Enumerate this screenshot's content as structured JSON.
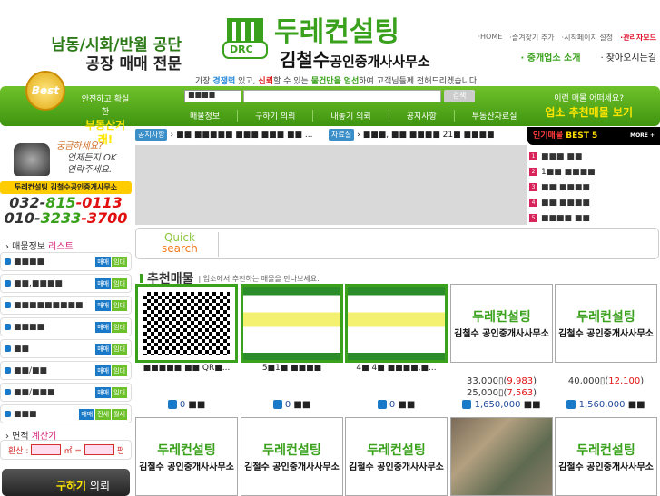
{
  "header": {
    "tagline_line1": "남동/시화/반월 공단",
    "tagline_line2": "공장 매매 전문",
    "logo_main": "두레컨설팅",
    "logo_sub": "김철수",
    "logo_sub2": "공인중개사사무소",
    "logo_mark": "DRC",
    "slogan": [
      "가장 ",
      "경쟁력",
      " 있고, ",
      "신뢰",
      "할 수 있는 ",
      "물건만을",
      " ",
      "엄선",
      "하여 고객님들께 전해드리겠습니다."
    ],
    "top_links": [
      "·HOME",
      "·즐겨찾기 추가",
      "·시작페이지 설정",
      "·관리자모드"
    ],
    "sub_links": [
      "· 중개업소 소개",
      "· 찾아오시는길"
    ]
  },
  "greenbar": {
    "medal": "Best",
    "safe_line1": "안전하고 확실한",
    "safe_line2": "부동산거래!",
    "select_value": "■■■■",
    "search_placeholder": "",
    "search_button": "검색",
    "nav": [
      "매물정보",
      "구하기 의뢰",
      "내놓기 의뢰",
      "공지사항",
      "부동산자료실"
    ],
    "rec_line1": "이런 매물 어떠세요?",
    "rec_line2": "업소 추천매물 보기"
  },
  "notice": {
    "badge": "공지사항",
    "text": "■■ ■■■■■ ■■■ ■■■ ■■ ..."
  },
  "data_room": {
    "badge": "자료실",
    "text": "■■■, ■■ ■■■■ 21■ ■■■■"
  },
  "best5": {
    "title_red": "인기매물",
    "title": " BEST 5",
    "more": "MORE +",
    "items": [
      "■■■ ■■",
      "1■■ ■■■■",
      "■■ ■■■■",
      "■■ ■■■■",
      "■■■■ ■■"
    ]
  },
  "quick": {
    "line1": "Quick",
    "line2": "search"
  },
  "recommend": {
    "title": "추천매물",
    "subtitle": "| 업소에서 추천하는 매물을 만나보세요."
  },
  "cards": [
    {
      "caption": "■■■■■ ■■ QR■...",
      "price1": "",
      "price1_red": "",
      "price2": "",
      "price2_red": "",
      "count": "0",
      "count_unit": "■■"
    },
    {
      "caption": "5■1■ ■■■■",
      "price1": "",
      "price1_red": "",
      "price2": "",
      "price2_red": "",
      "count": "0",
      "count_unit": "■■"
    },
    {
      "caption": "4■ 4■ ■■■■,■...",
      "price1": "",
      "price1_red": "",
      "price2": "",
      "price2_red": "",
      "count": "0",
      "count_unit": "■■"
    },
    {
      "caption": "",
      "price1": "33,000▯(",
      "price1_red": "9,983",
      "price2": "25,000▯(",
      "price2_red": "7,563",
      "count": "1,650,000",
      "count_unit": "■■"
    },
    {
      "caption": "",
      "price1": "40,000▯(",
      "price1_red": "12,100",
      "price2": "",
      "price2_red": "",
      "count": "1,560,000",
      "count_unit": "■■"
    }
  ],
  "sidebar": {
    "q_line1": "궁금하세요?",
    "q_line2": "언제든지 OK",
    "q_line3": "연락주세요.",
    "company": "두레컨설팅 김철수공인중개사무소",
    "phone1": [
      "032-",
      "815",
      "-0113"
    ],
    "phone2": [
      "010-",
      "3233",
      "-3700"
    ],
    "list_head": "› 매물정보 ",
    "list_head_accent": "리스트",
    "items": [
      {
        "label": "■■■■",
        "tags": [
          "매매",
          "임대"
        ]
      },
      {
        "label": "■■,■■■■",
        "tags": [
          "매매",
          "임대"
        ]
      },
      {
        "label": "■■■■■■■■■",
        "tags": [
          "매매",
          "임대"
        ]
      },
      {
        "label": "■■■■",
        "tags": [
          "매매",
          "임대"
        ]
      },
      {
        "label": "■■",
        "tags": [
          "매매",
          "임대"
        ]
      },
      {
        "label": "■■/■■",
        "tags": [
          "매매",
          "임대"
        ]
      },
      {
        "label": "■■/■■■",
        "tags": [
          "매매",
          "임대"
        ]
      },
      {
        "label": "■■■",
        "tags": [
          "매매",
          "전세",
          "월세"
        ]
      }
    ],
    "calc_head": "› 면적 ",
    "calc_head_accent": "계산기",
    "calc_label": "환산 :",
    "calc_unit1": "㎡ =",
    "calc_unit2": "평",
    "request_btn_a": "구하기",
    "request_btn_b": " 의뢰"
  }
}
